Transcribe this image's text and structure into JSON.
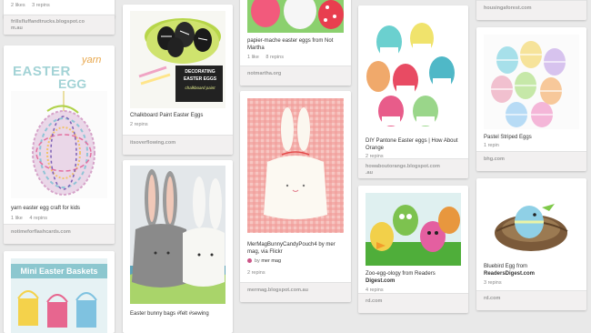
{
  "pins": {
    "p1": {
      "likes": "2 likes",
      "repins": "3 repins",
      "source": "frillsfluffandtrucks.blogspot.co\nm.au"
    },
    "p2": {
      "title_word1": "EASTER",
      "title_word2": "yarn",
      "title_word3": "EGG",
      "description": "yarn easter egg craft for kids",
      "likes": "1 like",
      "repins": "4 repins",
      "source": "notimeforflashcards.com"
    },
    "p3": {
      "image_text": "Mini Easter Baskets"
    },
    "p4": {
      "sign_text_1": "DECORATING",
      "sign_text_2": "EASTER EGGS",
      "sign_text_3": "chalkboard paint",
      "description": "Chalkboard Paint Easter Eggs",
      "repins": "2 repins",
      "source": "itsoverflowing.com"
    },
    "p5": {
      "description": "Easter bunny bags #felt #sewing"
    },
    "p6": {
      "description": "papier-mache easter eggs from Not\nMartha",
      "likes": "1 like",
      "repins": "8 repins",
      "source": "notmartha.org"
    },
    "p7": {
      "description": "MerMagBunnyCandyPouch4 by mer\nmag, via Flickr",
      "pinner_prefix": "by",
      "pinner_name": "mer mag",
      "repins": "2 repins",
      "source": "mermag.blogspot.com.au"
    },
    "p8": {
      "description": "DIY Pantone Easter eggs | How About\nOrange",
      "repins": "2 repins",
      "source": "howaboutorange.blogspot.com\n.au"
    },
    "p9": {
      "desc_line1": "Zoo-egg-ology from Readers",
      "desc_line2": "Digest.com",
      "repins": "4 repins",
      "source": "rd.com"
    },
    "p10": {
      "source": "housingaforest.com"
    },
    "p11": {
      "description": "Pastel Striped Eggs",
      "repins": "1 repin",
      "source": "bhg.com"
    },
    "p12": {
      "desc_line1": "Bluebird Egg from",
      "desc_line2": "ReadersDigest.com",
      "repins": "3 repins",
      "source": "rd.com"
    }
  },
  "colors": {
    "background": "#e9e9e9",
    "card": "#ffffff",
    "source_bar": "#f2f0f0",
    "source_text": "#9a9a9a"
  }
}
